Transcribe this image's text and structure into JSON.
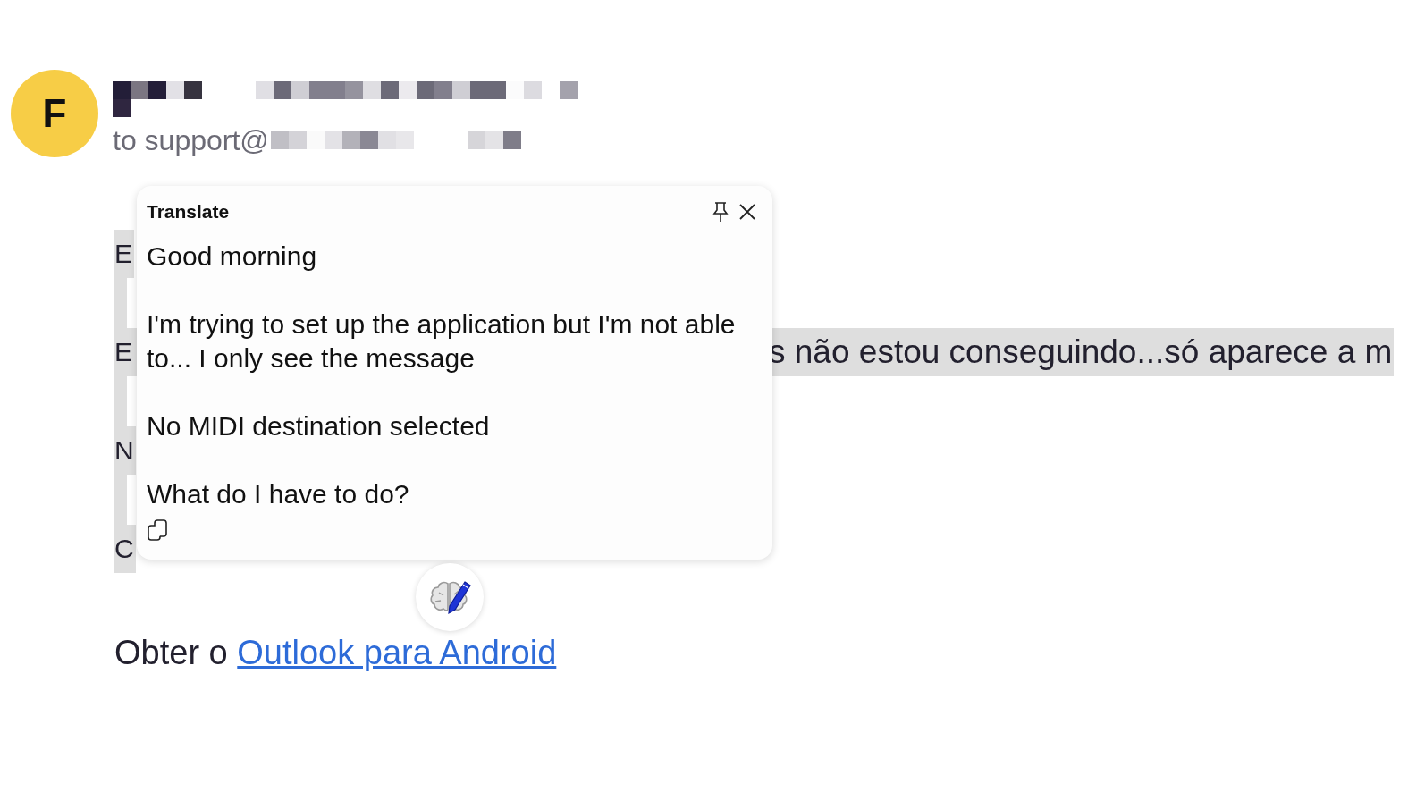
{
  "sender": {
    "avatar_letter": "F",
    "recipient_prefix": "to support@"
  },
  "body": {
    "paragraphs": [
      {
        "selected": true,
        "fragments": [
          "E"
        ]
      },
      {
        "selected": true,
        "fragments": [
          "E",
          "s não estou conseguindo...só aparece a m"
        ]
      },
      {
        "selected": true,
        "fragments": [
          "N"
        ]
      },
      {
        "selected": true,
        "fragments": [
          "C"
        ]
      }
    ],
    "footer": {
      "text": "Obter o ",
      "link": "Outlook para Android"
    }
  },
  "translate_popup": {
    "title": "Translate",
    "paragraphs": [
      "Good morning",
      "I'm trying to set up the application but I'm not able to... I only see the message",
      "No MIDI destination selected",
      "What do I have to do?"
    ]
  }
}
